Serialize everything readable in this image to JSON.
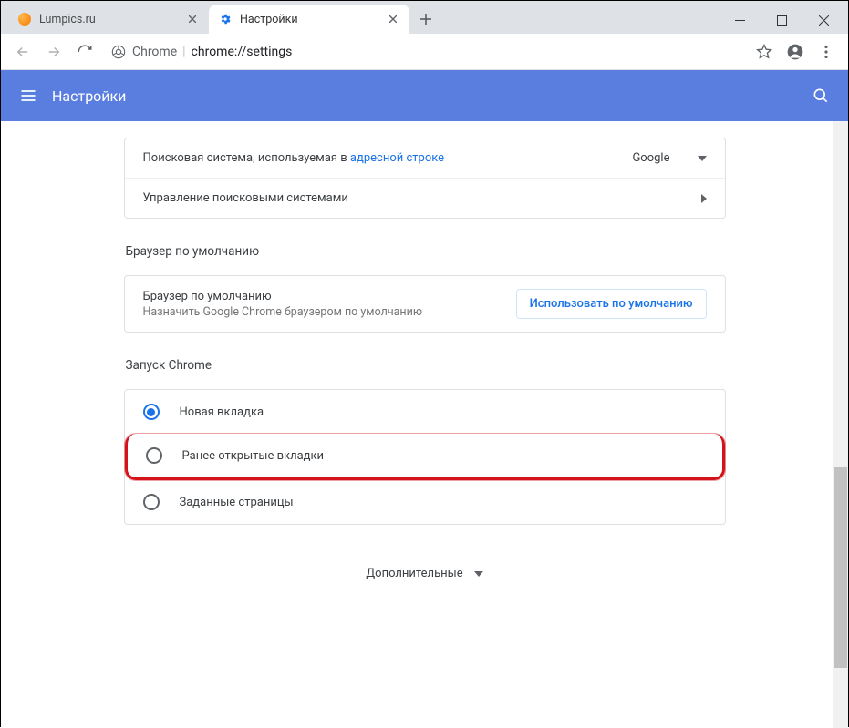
{
  "window": {
    "tabs": [
      {
        "label": "Lumpics.ru",
        "favicon": "orange"
      },
      {
        "label": "Настройки",
        "favicon": "gear"
      }
    ],
    "controls": {
      "min": "–",
      "max": "□",
      "close": "×"
    }
  },
  "address": {
    "prefix": "Chrome",
    "path": "chrome://settings"
  },
  "header": {
    "title": "Настройки"
  },
  "search_engine": {
    "label_prefix": "Поисковая система, используемая в ",
    "label_link": "адресной строке",
    "selected": "Google",
    "manage": "Управление поисковыми системами"
  },
  "default_browser": {
    "section": "Браузер по умолчанию",
    "title": "Браузер по умолчанию",
    "subtitle": "Назначить Google Chrome браузером по умолчанию",
    "button": "Использовать по умолчанию"
  },
  "startup": {
    "section": "Запуск Chrome",
    "options": [
      "Новая вкладка",
      "Ранее открытые вкладки",
      "Заданные страницы"
    ]
  },
  "more": "Дополнительные"
}
